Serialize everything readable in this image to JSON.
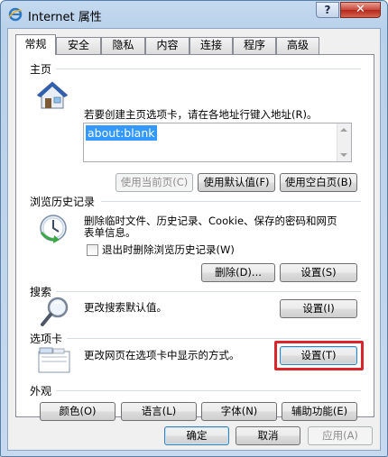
{
  "window": {
    "title": "Internet 属性",
    "help_label": "?",
    "close_label": "✕"
  },
  "tabs": [
    {
      "label": "常规",
      "active": true
    },
    {
      "label": "安全"
    },
    {
      "label": "隐私"
    },
    {
      "label": "内容"
    },
    {
      "label": "连接"
    },
    {
      "label": "程序"
    },
    {
      "label": "高级"
    }
  ],
  "homepage": {
    "section": "主页",
    "description": "若要创建主页选项卡，请在各地址行键入地址(R)。",
    "value": "about:blank",
    "use_current": "使用当前页(C)",
    "use_default": "使用默认值(F)",
    "use_blank": "使用空白页(B)"
  },
  "history": {
    "section": "浏览历史记录",
    "description_line1": "删除临时文件、历史记录、Cookie、保存的密码和网页",
    "description_line2": "表单信息。",
    "checkbox_label": "退出时删除浏览历史记录(W)",
    "checkbox_checked": false,
    "delete_button": "删除(D)...",
    "settings_button": "设置(S)"
  },
  "search": {
    "section": "搜索",
    "description": "更改搜索默认值。",
    "settings_button": "设置(I)"
  },
  "tabs_section": {
    "section": "选项卡",
    "description": "更改网页在选项卡中显示的方式。",
    "settings_button": "设置(T)",
    "highlight_color": "#d8262c"
  },
  "appearance": {
    "section": "外观",
    "colors_button": "颜色(O)",
    "languages_button": "语言(L)",
    "fonts_button": "字体(N)",
    "accessibility_button": "辅助功能(E)"
  },
  "footer": {
    "ok": "确定",
    "cancel": "取消",
    "apply": "应用(A)"
  }
}
